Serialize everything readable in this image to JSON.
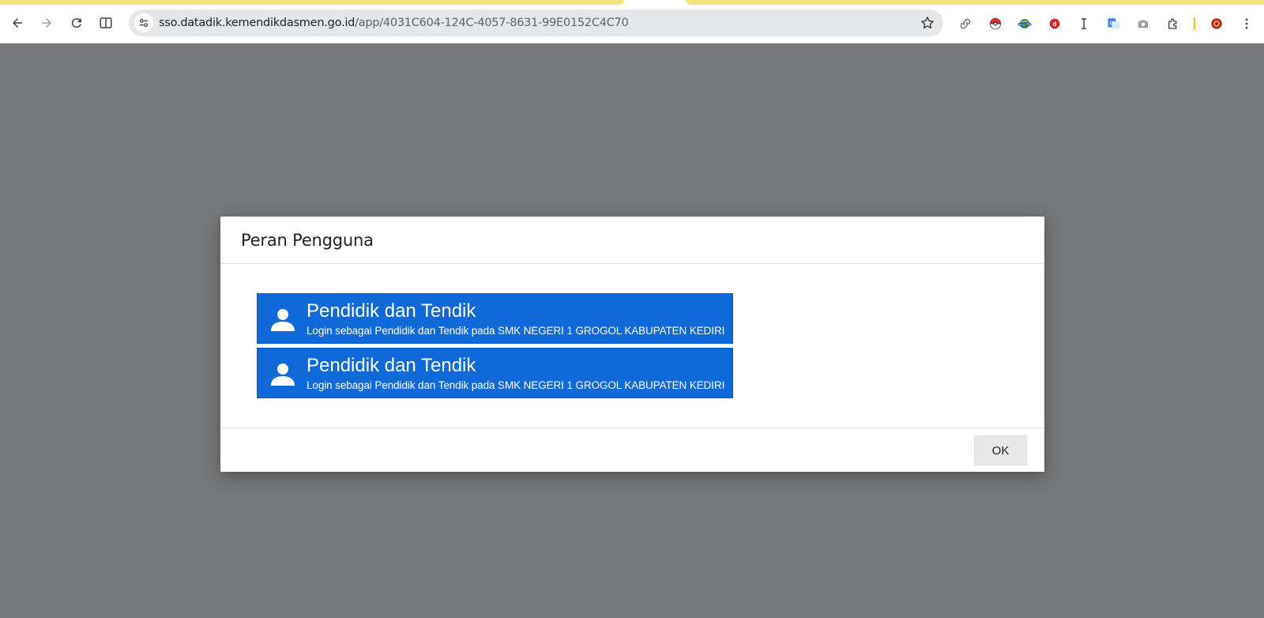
{
  "browser": {
    "url_host": "sso.datadik.kemendikdasmen.go.id",
    "url_path": "/app/4031C604-124C-4057-8631-99E0152C4C70",
    "nav_icons": [
      "back-icon",
      "forward-icon",
      "reload-icon",
      "split-view-icon"
    ],
    "extension_icons": [
      "link-icon",
      "pokeball-icon",
      "globe-icon",
      "red-circle-icon",
      "text-cursor-icon",
      "translate-icon",
      "camera-icon",
      "puzzle-icon",
      "profile-avatar-icon",
      "kebab-menu-icon"
    ],
    "accent_color": "#f7e47a"
  },
  "dialog": {
    "title": "Peran Pengguna",
    "roles": [
      {
        "title": "Pendidik dan Tendik",
        "description": "Login sebagai Pendidik dan Tendik pada SMK NEGERI 1 GROGOL KABUPATEN KEDIRI"
      },
      {
        "title": "Pendidik dan Tendik",
        "description": "Login sebagai Pendidik dan Tendik pada SMK NEGERI 1 GROGOL KABUPATEN KEDIRI"
      }
    ],
    "ok_label": "OK",
    "button_color": "#0f69d8"
  }
}
